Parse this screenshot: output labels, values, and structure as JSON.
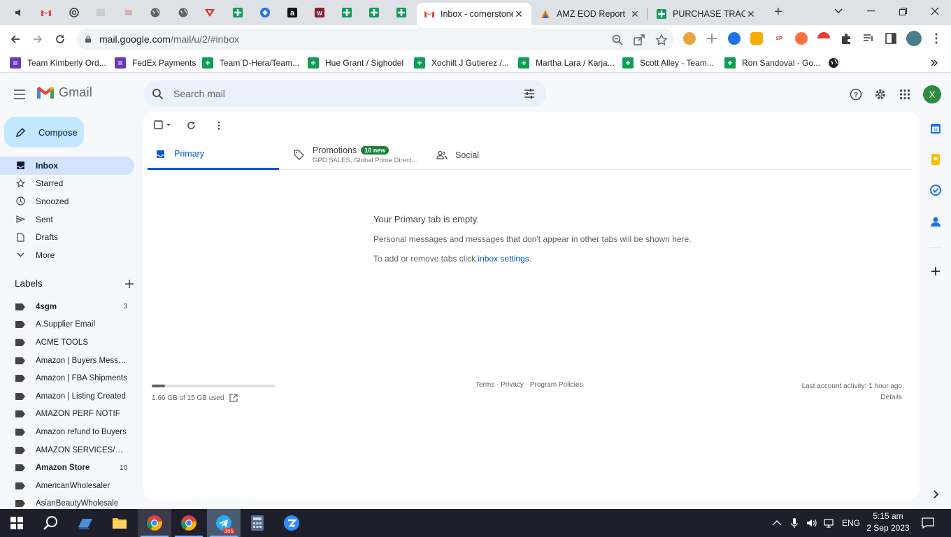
{
  "browser": {
    "tabs": [
      {
        "title": "Inbox - cornerstone",
        "icon": "gmail-icon",
        "active": true
      },
      {
        "title": "AMZ EOD Report",
        "icon": "app-icon"
      },
      {
        "title": "PURCHASE TRACKER",
        "icon": "sheets-icon"
      }
    ],
    "url_host": "mail.google.com",
    "url_path": "/mail/u/2/#inbox",
    "bookmarks": [
      {
        "label": "Team Kimberly Ord...",
        "icon": "forms-icon",
        "color": "#673ab7"
      },
      {
        "label": "FedEx Payments",
        "icon": "forms-icon",
        "color": "#673ab7"
      },
      {
        "label": "Team D-Hera/Team...",
        "icon": "sheets-icon",
        "color": "#0f9d58"
      },
      {
        "label": "Hue Grant / Sighodel",
        "icon": "sheets-icon",
        "color": "#0f9d58"
      },
      {
        "label": "Xochilt J Gutierez /...",
        "icon": "sheets-icon",
        "color": "#0f9d58"
      },
      {
        "label": "Martha Lara / Karja...",
        "icon": "sheets-icon",
        "color": "#0f9d58"
      },
      {
        "label": "Scott Alley - Team...",
        "icon": "sheets-icon",
        "color": "#0f9d58"
      },
      {
        "label": "Ron Sandoval - Go...",
        "icon": "sheets-icon",
        "color": "#0f9d58"
      }
    ]
  },
  "gmail": {
    "logo_text": "Gmail",
    "search_placeholder": "Search mail",
    "avatar_letter": "X",
    "compose_label": "Compose",
    "nav": [
      {
        "label": "Inbox",
        "icon": "inbox-icon",
        "selected": true
      },
      {
        "label": "Starred",
        "icon": "star-icon"
      },
      {
        "label": "Snoozed",
        "icon": "clock-icon"
      },
      {
        "label": "Sent",
        "icon": "send-icon"
      },
      {
        "label": "Drafts",
        "icon": "draft-icon"
      },
      {
        "label": "More",
        "icon": "chevron-down-icon"
      }
    ],
    "labels_title": "Labels",
    "labels": [
      {
        "name": "4sgm",
        "count": "3",
        "bold": true
      },
      {
        "name": "A.Supplier Email",
        "count": ""
      },
      {
        "name": "ACME TOOLS",
        "count": ""
      },
      {
        "name": "Amazon | Buyers Messa...",
        "count": ""
      },
      {
        "name": "Amazon | FBA Shipments",
        "count": ""
      },
      {
        "name": "Amazon | Listing Created",
        "count": ""
      },
      {
        "name": "AMAZON PERF NOTIF",
        "count": ""
      },
      {
        "name": "Amazon refund to Buyers",
        "count": ""
      },
      {
        "name": "AMAZON SERVICES/PAY...",
        "count": ""
      },
      {
        "name": "Amazon Store",
        "count": "10",
        "bold": true
      },
      {
        "name": "AmericanWholesaler",
        "count": ""
      },
      {
        "name": "AsianBeautyWholesale",
        "count": ""
      }
    ],
    "tabs": {
      "primary": "Primary",
      "promotions": "Promotions",
      "promotions_badge": "10 new",
      "promotions_sub": "GPD SALES, Global Prime Direct...",
      "social": "Social"
    },
    "empty": {
      "title": "Your Primary tab is empty.",
      "line1": "Personal messages and messages that don't appear in other tabs will be shown here.",
      "line2_prefix": "To add or remove tabs click ",
      "line2_link": "inbox settings",
      "line2_suffix": "."
    },
    "storage": {
      "text": "1.66 GB of 15 GB used",
      "fraction": 0.11
    },
    "footer": {
      "terms": "Terms",
      "privacy": "Privacy",
      "policies": "Program Policies",
      "sep": " · "
    },
    "activity": {
      "text": "Last account activity: 1 hour ago",
      "details": "Details"
    }
  },
  "taskbar": {
    "language": "ENG",
    "time": "5:15 am",
    "date": "2 Sep 2023",
    "telegram_badge": "365"
  }
}
